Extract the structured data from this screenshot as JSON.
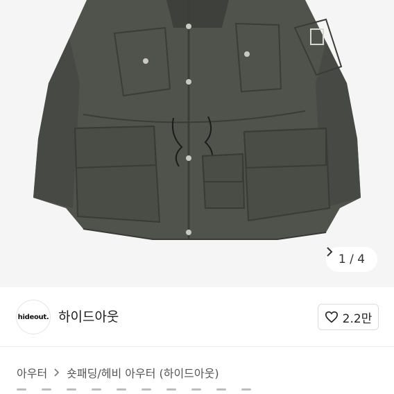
{
  "product_image": {
    "description_icon": "jacket-photo",
    "background": "#f5f5f5",
    "jacket_color": "#4f524b"
  },
  "pager": {
    "label": "1 / 4",
    "current": 1,
    "total": 4
  },
  "seller": {
    "avatar_text": "hideout.",
    "name": "하이드아웃",
    "likes": "2.2만"
  },
  "breadcrumb": {
    "items": [
      "아우터",
      "숏패딩/헤비 아우터 (하이드아웃)"
    ]
  }
}
